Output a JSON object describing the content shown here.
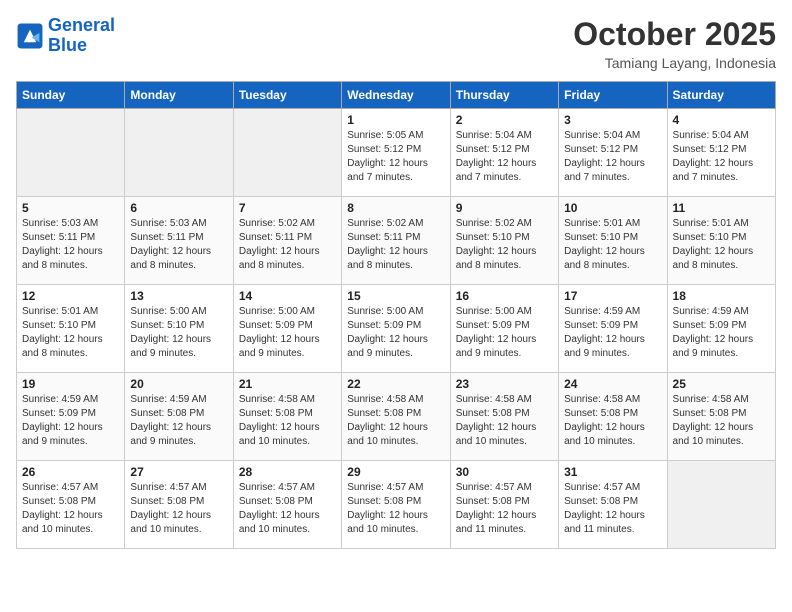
{
  "header": {
    "logo_line1": "General",
    "logo_line2": "Blue",
    "month_title": "October 2025",
    "location": "Tamiang Layang, Indonesia"
  },
  "weekdays": [
    "Sunday",
    "Monday",
    "Tuesday",
    "Wednesday",
    "Thursday",
    "Friday",
    "Saturday"
  ],
  "weeks": [
    [
      {
        "day": "",
        "info": ""
      },
      {
        "day": "",
        "info": ""
      },
      {
        "day": "",
        "info": ""
      },
      {
        "day": "1",
        "info": "Sunrise: 5:05 AM\nSunset: 5:12 PM\nDaylight: 12 hours\nand 7 minutes."
      },
      {
        "day": "2",
        "info": "Sunrise: 5:04 AM\nSunset: 5:12 PM\nDaylight: 12 hours\nand 7 minutes."
      },
      {
        "day": "3",
        "info": "Sunrise: 5:04 AM\nSunset: 5:12 PM\nDaylight: 12 hours\nand 7 minutes."
      },
      {
        "day": "4",
        "info": "Sunrise: 5:04 AM\nSunset: 5:12 PM\nDaylight: 12 hours\nand 7 minutes."
      }
    ],
    [
      {
        "day": "5",
        "info": "Sunrise: 5:03 AM\nSunset: 5:11 PM\nDaylight: 12 hours\nand 8 minutes."
      },
      {
        "day": "6",
        "info": "Sunrise: 5:03 AM\nSunset: 5:11 PM\nDaylight: 12 hours\nand 8 minutes."
      },
      {
        "day": "7",
        "info": "Sunrise: 5:02 AM\nSunset: 5:11 PM\nDaylight: 12 hours\nand 8 minutes."
      },
      {
        "day": "8",
        "info": "Sunrise: 5:02 AM\nSunset: 5:11 PM\nDaylight: 12 hours\nand 8 minutes."
      },
      {
        "day": "9",
        "info": "Sunrise: 5:02 AM\nSunset: 5:10 PM\nDaylight: 12 hours\nand 8 minutes."
      },
      {
        "day": "10",
        "info": "Sunrise: 5:01 AM\nSunset: 5:10 PM\nDaylight: 12 hours\nand 8 minutes."
      },
      {
        "day": "11",
        "info": "Sunrise: 5:01 AM\nSunset: 5:10 PM\nDaylight: 12 hours\nand 8 minutes."
      }
    ],
    [
      {
        "day": "12",
        "info": "Sunrise: 5:01 AM\nSunset: 5:10 PM\nDaylight: 12 hours\nand 8 minutes."
      },
      {
        "day": "13",
        "info": "Sunrise: 5:00 AM\nSunset: 5:10 PM\nDaylight: 12 hours\nand 9 minutes."
      },
      {
        "day": "14",
        "info": "Sunrise: 5:00 AM\nSunset: 5:09 PM\nDaylight: 12 hours\nand 9 minutes."
      },
      {
        "day": "15",
        "info": "Sunrise: 5:00 AM\nSunset: 5:09 PM\nDaylight: 12 hours\nand 9 minutes."
      },
      {
        "day": "16",
        "info": "Sunrise: 5:00 AM\nSunset: 5:09 PM\nDaylight: 12 hours\nand 9 minutes."
      },
      {
        "day": "17",
        "info": "Sunrise: 4:59 AM\nSunset: 5:09 PM\nDaylight: 12 hours\nand 9 minutes."
      },
      {
        "day": "18",
        "info": "Sunrise: 4:59 AM\nSunset: 5:09 PM\nDaylight: 12 hours\nand 9 minutes."
      }
    ],
    [
      {
        "day": "19",
        "info": "Sunrise: 4:59 AM\nSunset: 5:09 PM\nDaylight: 12 hours\nand 9 minutes."
      },
      {
        "day": "20",
        "info": "Sunrise: 4:59 AM\nSunset: 5:08 PM\nDaylight: 12 hours\nand 9 minutes."
      },
      {
        "day": "21",
        "info": "Sunrise: 4:58 AM\nSunset: 5:08 PM\nDaylight: 12 hours\nand 10 minutes."
      },
      {
        "day": "22",
        "info": "Sunrise: 4:58 AM\nSunset: 5:08 PM\nDaylight: 12 hours\nand 10 minutes."
      },
      {
        "day": "23",
        "info": "Sunrise: 4:58 AM\nSunset: 5:08 PM\nDaylight: 12 hours\nand 10 minutes."
      },
      {
        "day": "24",
        "info": "Sunrise: 4:58 AM\nSunset: 5:08 PM\nDaylight: 12 hours\nand 10 minutes."
      },
      {
        "day": "25",
        "info": "Sunrise: 4:58 AM\nSunset: 5:08 PM\nDaylight: 12 hours\nand 10 minutes."
      }
    ],
    [
      {
        "day": "26",
        "info": "Sunrise: 4:57 AM\nSunset: 5:08 PM\nDaylight: 12 hours\nand 10 minutes."
      },
      {
        "day": "27",
        "info": "Sunrise: 4:57 AM\nSunset: 5:08 PM\nDaylight: 12 hours\nand 10 minutes."
      },
      {
        "day": "28",
        "info": "Sunrise: 4:57 AM\nSunset: 5:08 PM\nDaylight: 12 hours\nand 10 minutes."
      },
      {
        "day": "29",
        "info": "Sunrise: 4:57 AM\nSunset: 5:08 PM\nDaylight: 12 hours\nand 10 minutes."
      },
      {
        "day": "30",
        "info": "Sunrise: 4:57 AM\nSunset: 5:08 PM\nDaylight: 12 hours\nand 11 minutes."
      },
      {
        "day": "31",
        "info": "Sunrise: 4:57 AM\nSunset: 5:08 PM\nDaylight: 12 hours\nand 11 minutes."
      },
      {
        "day": "",
        "info": ""
      }
    ]
  ]
}
